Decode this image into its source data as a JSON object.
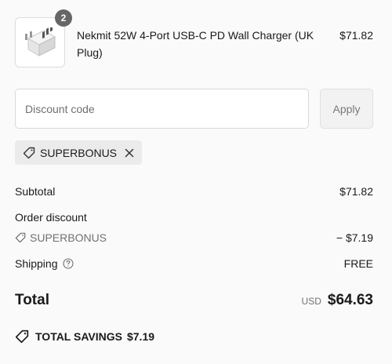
{
  "product": {
    "quantity": "2",
    "name": "Nekmit 52W 4-Port USB-C PD Wall Charger (UK Plug)",
    "price": "$71.82"
  },
  "discount": {
    "placeholder": "Discount code",
    "apply_label": "Apply",
    "applied_code": "SUPERBONUS"
  },
  "summary": {
    "subtotal_label": "Subtotal",
    "subtotal_value": "$71.82",
    "order_discount_label": "Order discount",
    "discount_code": "SUPERBONUS",
    "discount_value": "− $7.19",
    "shipping_label": "Shipping",
    "shipping_value": "FREE",
    "total_label": "Total",
    "currency": "USD",
    "total_value": "$64.63"
  },
  "savings": {
    "label": "TOTAL SAVINGS",
    "value": "$7.19"
  },
  "icons": {
    "tag": "tag-icon",
    "close": "close-icon",
    "info": "question-circle-icon",
    "product_image": "charger-image"
  }
}
